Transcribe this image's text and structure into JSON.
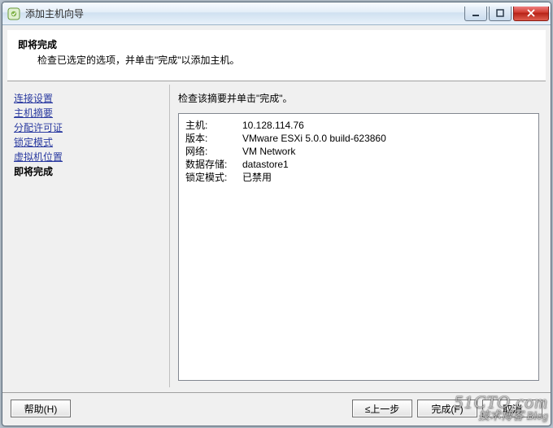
{
  "window": {
    "title": "添加主机向导"
  },
  "header": {
    "title": "即将完成",
    "subtitle": "检查已选定的选项，并单击\"完成\"以添加主机。"
  },
  "sidebar": {
    "items": [
      {
        "label": "连接设置"
      },
      {
        "label": "主机摘要"
      },
      {
        "label": "分配许可证"
      },
      {
        "label": "锁定模式"
      },
      {
        "label": "虚拟机位置"
      }
    ],
    "current": "即将完成"
  },
  "main": {
    "instruction": "检查该摘要并单击\"完成\"。",
    "summary": [
      {
        "label": "主机:",
        "value": "10.128.114.76"
      },
      {
        "label": "版本:",
        "value": "VMware ESXi 5.0.0 build-623860"
      },
      {
        "label": "网络:",
        "value": "VM Network"
      },
      {
        "label": "数据存储:",
        "value": "datastore1"
      },
      {
        "label": "锁定模式:",
        "value": "已禁用"
      }
    ]
  },
  "footer": {
    "help": "帮助(H)",
    "back": "≤上一步",
    "finish": "完成(F)",
    "cancel": "取消"
  },
  "watermark": {
    "line1": "51CTO.com",
    "line2": "技术博客 Blog"
  }
}
